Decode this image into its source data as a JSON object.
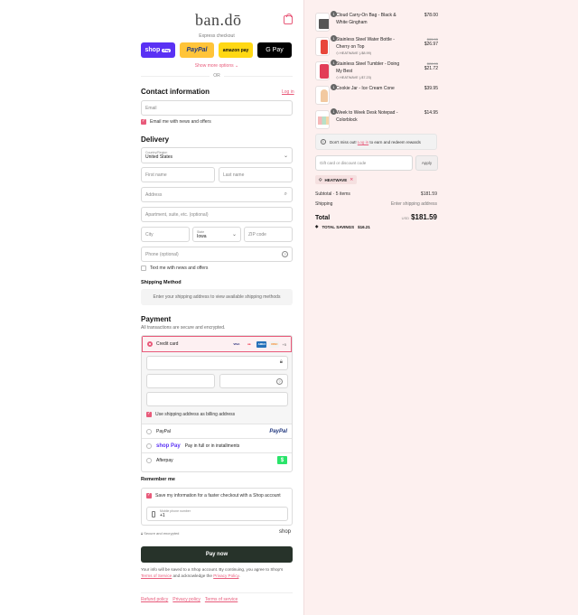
{
  "brand": {
    "logo": "ban.dō",
    "accent": "#e85a7a"
  },
  "express": {
    "label": "Express checkout",
    "buttons": [
      "shop",
      "Pay",
      "PayPal",
      "amazon pay",
      "G Pay"
    ],
    "more": "Show more options ⌄",
    "or": "OR"
  },
  "contact": {
    "title": "Contact information",
    "login": "Log in",
    "email_placeholder": "Email",
    "newsletter": "Email me with news and offers"
  },
  "delivery": {
    "title": "Delivery",
    "country_label": "Country/Region",
    "country_value": "United States",
    "first_name": "First name",
    "last_name": "Last name",
    "address": "Address",
    "apartment": "Apartment, suite, etc. (optional)",
    "city": "City",
    "state_label": "State",
    "state_value": "Iowa",
    "zip": "ZIP code",
    "phone": "Phone (optional)",
    "text_me": "Text me with news and offers"
  },
  "shipping": {
    "title": "Shipping Method",
    "message": "Enter your shipping address to view available shipping methods"
  },
  "payment": {
    "title": "Payment",
    "subtitle": "All transactions are secure and encrypted.",
    "credit_card": "Credit card",
    "card_logos": [
      "VISA",
      "MC",
      "AMEX",
      "DISC"
    ],
    "more_cards": "+5",
    "billing_same": "Use shipping address as billing address",
    "paypal": "PayPal",
    "paypal_logo": "PayPal",
    "shop_pay_logo": "shop Pay",
    "shop_pay": "Pay in full or in installments",
    "afterpay": "Afterpay",
    "afterpay_logo": "$"
  },
  "remember": {
    "title": "Remember me",
    "save_info": "Save my information for a faster checkout with a Shop account",
    "mobile_label": "Mobile phone number",
    "mobile_value": "+1",
    "secure": "Secure and encrypted",
    "shop": "shop"
  },
  "pay_now": "Pay now",
  "legal": {
    "p1": "Your info will be saved to a Shop account. By continuing, you agree to Shop's ",
    "tos": "Terms of Service",
    "p2": " and acknowledge the ",
    "privacy": "Privacy Policy",
    "p3": "."
  },
  "footer": [
    "Refund policy",
    "Privacy policy",
    "Terms of service"
  ],
  "cart": {
    "items": [
      {
        "qty": "1",
        "title": "Cloud Carry-On Bag - Black & White Gingham",
        "price": "$78.00",
        "discount": "",
        "original": "",
        "thumb_color": "#555"
      },
      {
        "qty": "1",
        "title": "Stainless Steel Water Bottle - Cherry on Top",
        "price": "$26.97",
        "discount": "HEATWAVE (-$8.99)",
        "original": "$35.95",
        "thumb_color": "#e8463a"
      },
      {
        "qty": "1",
        "title": "Stainless Steel Tumbler - Doing My Best",
        "price": "$21.72",
        "discount": "HEATWAVE (-$7.23)",
        "original": "$28.95",
        "thumb_color": "#e23d58"
      },
      {
        "qty": "1",
        "title": "Cookie Jar - Ice Cream Cone",
        "price": "$39.95",
        "discount": "",
        "original": "",
        "thumb_color": "#f2c9a0"
      },
      {
        "qty": "1",
        "title": "Week to Week Desk Notepad - Colorblock",
        "price": "$14.95",
        "discount": "",
        "original": "",
        "thumb_color": "#f5b8b8"
      }
    ],
    "notice": "Don't miss out! ",
    "notice_link": "Log in",
    "notice_rest": " to earn and redeem rewards",
    "gift_placeholder": "Gift card or discount code",
    "apply": "Apply",
    "code": "HEATWAVE",
    "subtotal_label": "Subtotal · 5 items",
    "subtotal": "$181.59",
    "shipping_label": "Shipping",
    "shipping_value": "Enter shipping address",
    "total_label": "Total",
    "currency": "USD",
    "total": "$181.59",
    "savings_label": "TOTAL SAVINGS",
    "savings": "$16.21"
  }
}
